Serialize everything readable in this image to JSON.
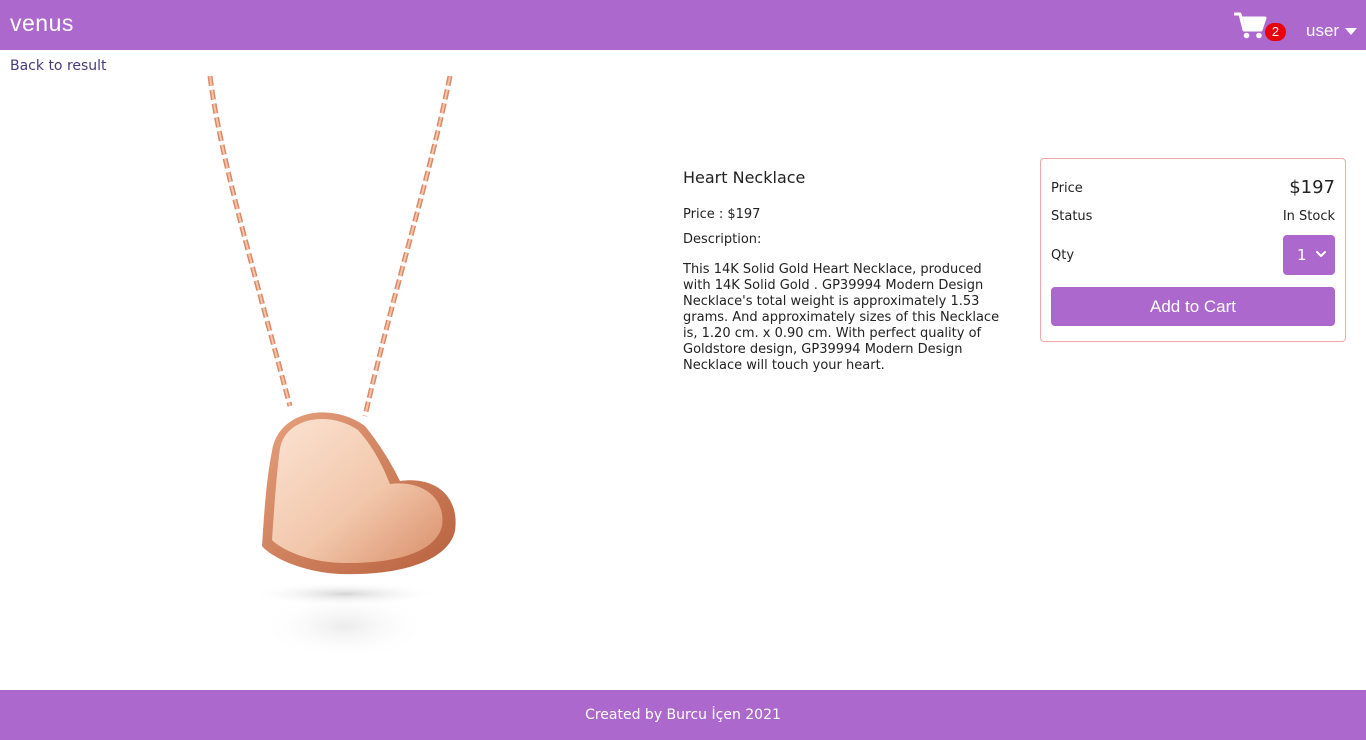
{
  "navbar": {
    "brand": "venus",
    "cart_icon": "shopping-cart-icon",
    "cart_count": "2",
    "user_label": "user",
    "user_caret_icon": "caret-down-icon",
    "bg_color": "#ac68cd"
  },
  "back_link": "Back to result",
  "product": {
    "image_alt": "heart-necklace-photo",
    "name": "Heart Necklace",
    "price_line": "Price : $197",
    "description_label": "Description:",
    "description": "This 14K Solid Gold Heart Necklace, produced with 14K Solid Gold . GP39994 Modern Design Necklace's total weight is approximately 1.53 grams. And approximately sizes of this Necklace is, 1.20 cm. x 0.90 cm. With perfect quality of Goldstore design, GP39994 Modern Design Necklace will touch your heart."
  },
  "buy_card": {
    "price_label": "Price",
    "price_value": "$197",
    "status_label": "Status",
    "status_value": "In Stock",
    "qty_label": "Qty",
    "qty_selected": "1",
    "add_button": "Add to Cart",
    "border_color": "#f0a8ad"
  },
  "footer": {
    "text": "Created by Burcu İçen 2021"
  }
}
